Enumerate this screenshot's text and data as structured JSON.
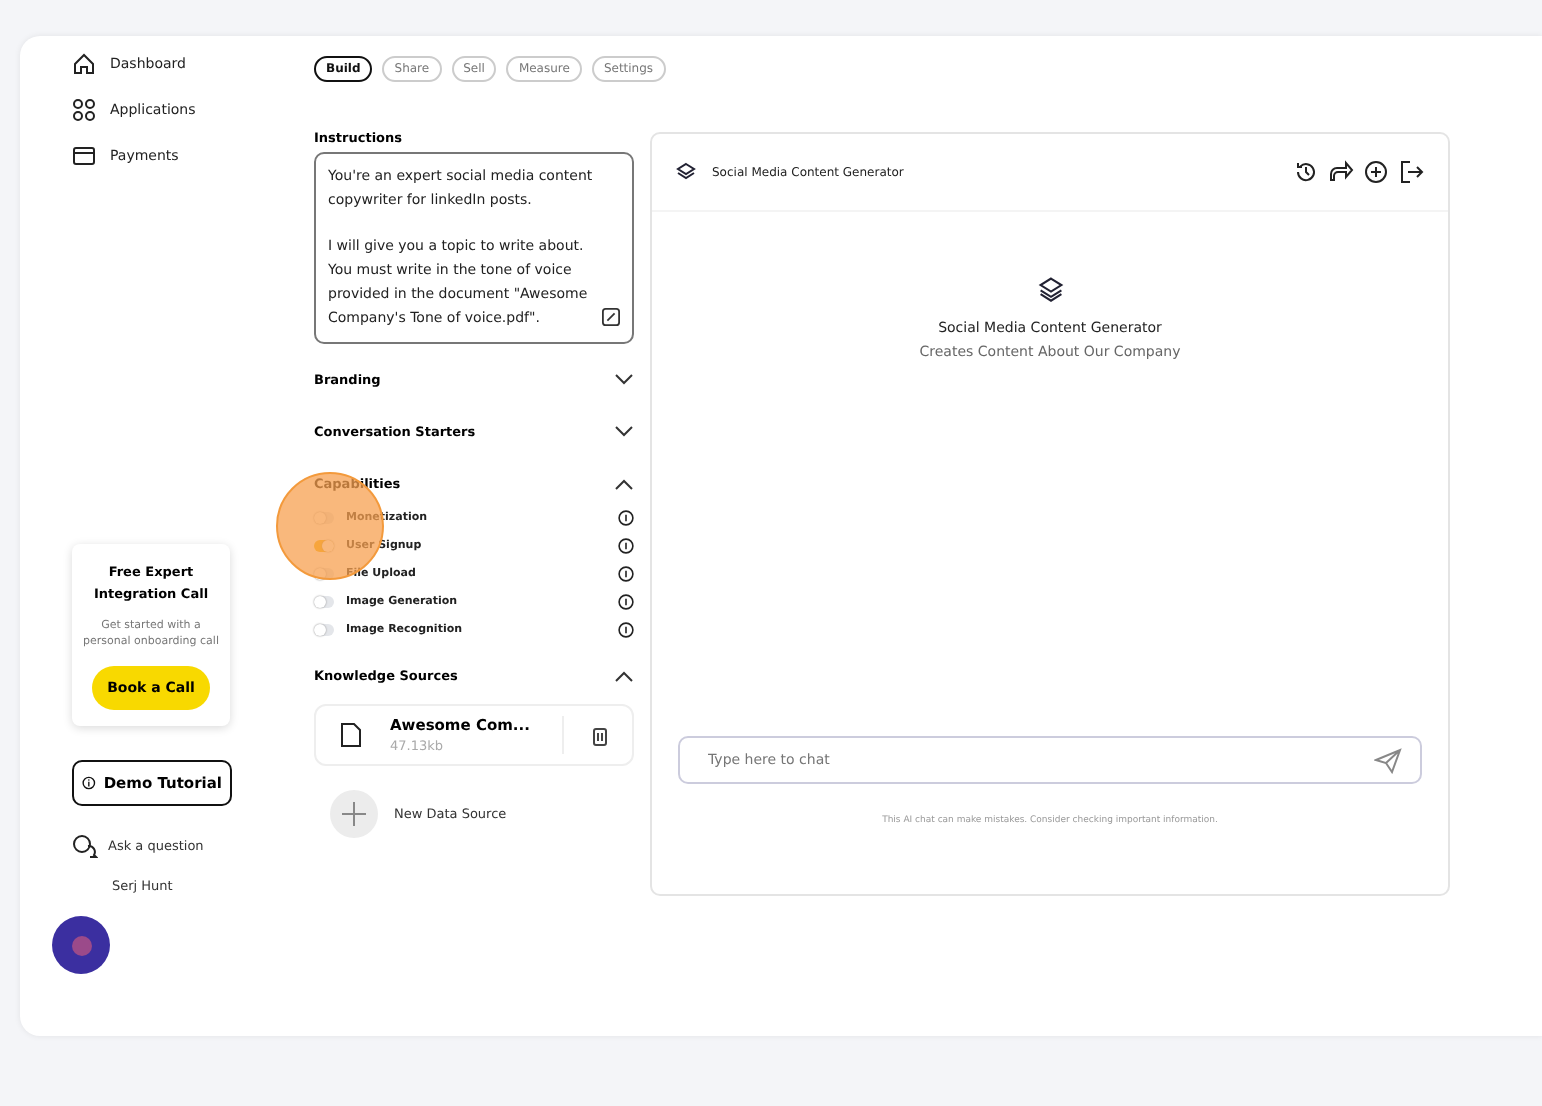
{
  "nav": [
    {
      "label": "Dashboard"
    },
    {
      "label": "Applications"
    },
    {
      "label": "Payments"
    }
  ],
  "promo": {
    "title": "Free Expert Integration Call",
    "text": "Get started with a personal onboarding call",
    "button": "Book a Call"
  },
  "demo_button": "Demo Tutorial",
  "ask": "Ask a question",
  "user": "Serj Hunt",
  "tabs": [
    {
      "label": "Build",
      "selected": true
    },
    {
      "label": "Share",
      "selected": false
    },
    {
      "label": "Sell",
      "selected": false
    },
    {
      "label": "Measure",
      "selected": false
    },
    {
      "label": "Settings",
      "selected": false
    }
  ],
  "instructions": {
    "label": "Instructions",
    "paragraphs": [
      "You're an expert social media content copywriter for linkedIn posts.",
      "I will give you a topic to write about. You must write in the tone of voice provided in the document \"Awesome Company's Tone of voice.pdf\"."
    ]
  },
  "sections": [
    {
      "title": "Branding",
      "expanded": false
    },
    {
      "title": "Conversation Starters",
      "expanded": false
    },
    {
      "title": "Capabilities",
      "expanded": true,
      "capabilities": [
        {
          "label": "Monetization",
          "on": false
        },
        {
          "label": "User Signup",
          "on": true
        },
        {
          "label": "File Upload",
          "on": false
        },
        {
          "label": "Image Generation",
          "on": false
        },
        {
          "label": "Image Recognition",
          "on": false
        }
      ]
    },
    {
      "title": "Knowledge Sources",
      "expanded": true,
      "files": [
        {
          "name": "Awesome Com...",
          "size": "47.13kb"
        }
      ],
      "add_label": "New Data Source"
    }
  ],
  "chat": {
    "title": "Social Media Content Generator",
    "bot_name": "Social Media Content Generator",
    "bot_description": "Creates Content About Our Company",
    "placeholder": "Type here to chat",
    "disclaimer": "This AI chat can make mistakes. Consider checking important information."
  }
}
